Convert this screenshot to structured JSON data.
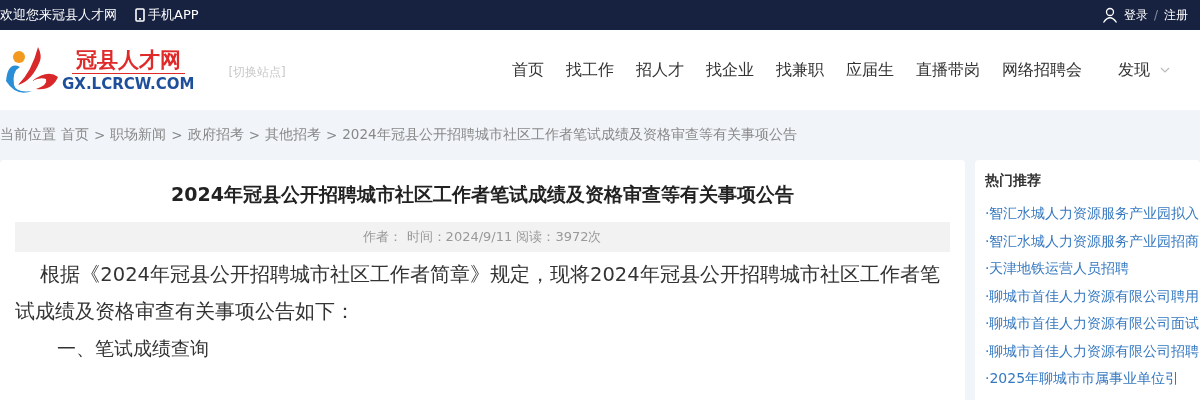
{
  "top_bar": {
    "welcome": "欢迎您来冠县人才网",
    "app_link": "手机APP",
    "login": "登录",
    "separator": "/",
    "register": "注册"
  },
  "logo": {
    "name": "冠县人才网",
    "domain": "GX.LCRCW.COM",
    "switch_site": "[切换站点]"
  },
  "nav": [
    {
      "label": "首页"
    },
    {
      "label": "找工作"
    },
    {
      "label": "招人才"
    },
    {
      "label": "找企业"
    },
    {
      "label": "找兼职"
    },
    {
      "label": "应届生"
    },
    {
      "label": "直播带岗"
    },
    {
      "label": "网络招聘会"
    },
    {
      "label": "发现",
      "dropdown": true
    }
  ],
  "breadcrumb": {
    "prefix": "当前位置",
    "separator": ">",
    "items": [
      "首页",
      "职场新闻",
      "政府招考",
      "其他招考",
      "2024年冠县公开招聘城市社区工作者笔试成绩及资格审查等有关事项公告"
    ]
  },
  "article": {
    "title": "2024年冠县公开招聘城市社区工作者笔试成绩及资格审查等有关事项公告",
    "meta": "作者：  时间：2024/9/11 阅读：3972次",
    "paragraphs": [
      {
        "kind": "body",
        "text": "根据《2024年冠县公开招聘城市社区工作者简章》规定，现将2024年冠县公开招聘城市社区工作者笔试成绩及资格审查有关事项公告如下："
      },
      {
        "kind": "heading",
        "text": "一、笔试成绩查询"
      }
    ]
  },
  "sidebar": {
    "title": "热门推荐",
    "items": [
      "·智汇水城人力资源服务产业园拟入",
      "·智汇水城人力资源服务产业园招商",
      "·天津地铁运营人员招聘",
      "·聊城市首佳人力资源有限公司聘用",
      "·聊城市首佳人力资源有限公司面试",
      "·聊城市首佳人力资源有限公司招聘",
      "·2025年聊城市市属事业单位引"
    ]
  }
}
